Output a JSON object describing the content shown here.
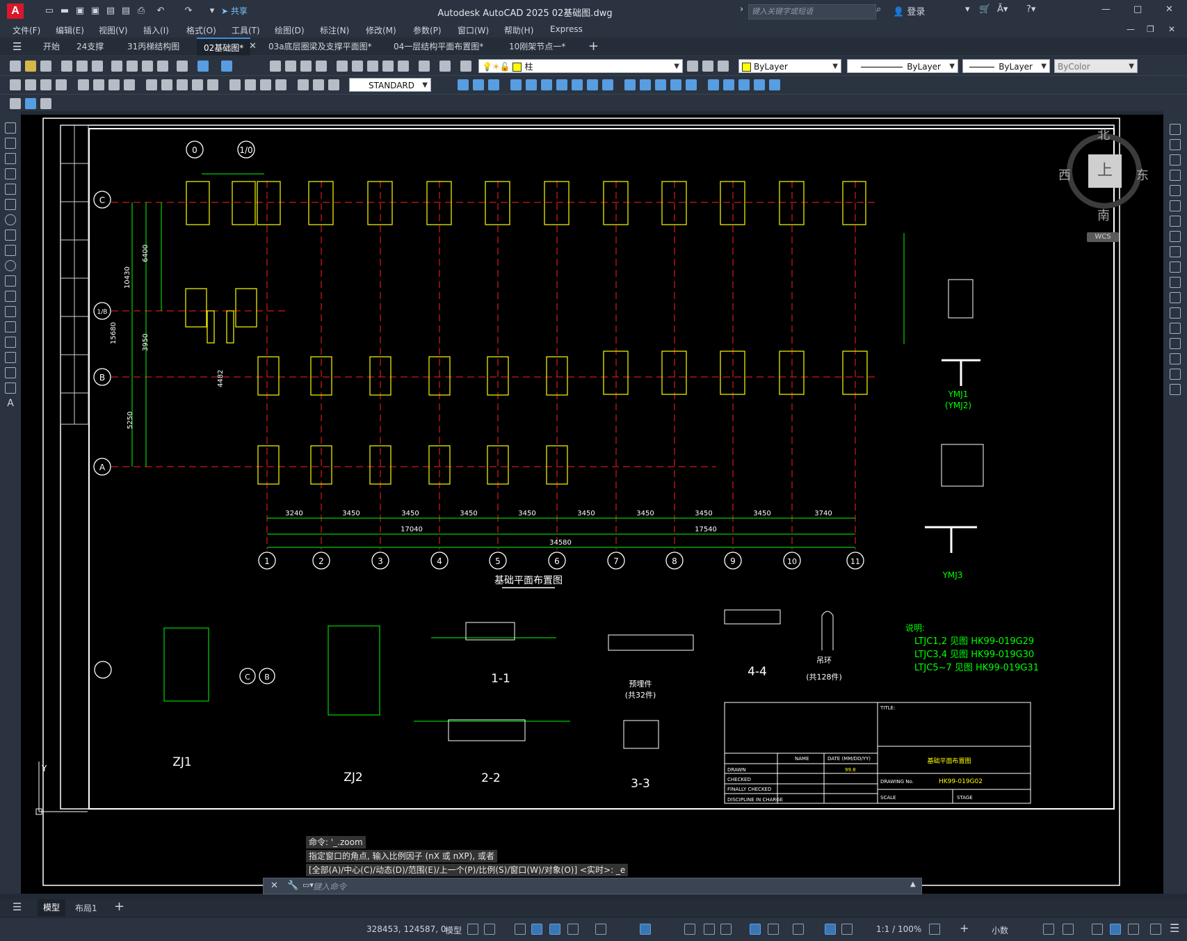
{
  "app": {
    "title": "Autodesk AutoCAD 2025    02基础图.dwg",
    "share": "共享",
    "search_placeholder": "键入关键字或短语",
    "login": "登录"
  },
  "menu": [
    "文件(F)",
    "编辑(E)",
    "视图(V)",
    "插入(I)",
    "格式(O)",
    "工具(T)",
    "绘图(D)",
    "标注(N)",
    "修改(M)",
    "参数(P)",
    "窗口(W)",
    "帮助(H)",
    "Express"
  ],
  "tabs": [
    {
      "label": "开始",
      "active": false
    },
    {
      "label": "24支撑",
      "active": false
    },
    {
      "label": "31丙梯结构图",
      "active": false
    },
    {
      "label": "02基础图*",
      "active": true
    },
    {
      "label": "03a底层圈梁及支撑平面图*",
      "active": false
    },
    {
      "label": "04一层结构平面布置图*",
      "active": false
    },
    {
      "label": "10刚架节点一*",
      "active": false
    }
  ],
  "toolbar": {
    "layer": "柱",
    "color": "ByLayer",
    "linetype": "ByLayer",
    "lineweight": "ByLayer",
    "plotstyle": "ByColor",
    "textstyle": "STANDARD"
  },
  "viewcube": {
    "north": "北",
    "south": "南",
    "east": "东",
    "west": "西",
    "top": "上",
    "wcs": "WCS"
  },
  "drawing": {
    "main_title": "基础平面布置图",
    "col_labels": [
      "1",
      "2",
      "3",
      "4",
      "5",
      "6",
      "7",
      "8",
      "9",
      "10",
      "11"
    ],
    "row_labels": [
      "C",
      "1/B",
      "B",
      "A"
    ],
    "top_axes": [
      "0",
      "1/0"
    ],
    "bay_dims": [
      "3240",
      "3450",
      "3450",
      "3450",
      "3450",
      "3450",
      "3450",
      "3450",
      "3450",
      "3740"
    ],
    "sub_totals": [
      "17040",
      "17540"
    ],
    "total": "34580",
    "left_dims": [
      "10430",
      "15680",
      "3950",
      "6400",
      "4482",
      "5250"
    ],
    "notes_title": "说明:",
    "notes": [
      "LTJC1,2 见图 HK99-019G29",
      "LTJC3,4 见图 HK99-019G30",
      "LTJC5~7 见图 HK99-019G31"
    ],
    "details": [
      "ZJ1",
      "ZJ2",
      "1-1",
      "2-2",
      "3-3",
      "4-4",
      "YMJ1",
      "(YMJ2)",
      "YMJ3"
    ],
    "detail_sub": {
      "yumaijian": "预埋件",
      "gong32": "(共32件)",
      "diaohuan": "吊环",
      "gong128": "(共128件)"
    },
    "title_block": {
      "title_label": "TITLE:",
      "title": "基础平面布置图",
      "name": "NAME",
      "date": "DATE (MM/DD/YY)",
      "date_val": "99.8",
      "drawn": "DRAWN",
      "checked": "CHECKED",
      "final": "FINALLY CHECKED",
      "discipline": "DISCIPLINE IN CHARGE",
      "drawing_no_label": "DRAWING No.",
      "drawing_no": "HK99-019G02",
      "scale": "SCALE",
      "stage": "STAGE"
    }
  },
  "command": {
    "history": [
      "命令: '_.zoom",
      "指定窗口的角点, 输入比例因子 (nX 或 nXP), 或者",
      "[全部(A)/中心(C)/动态(D)/范围(E)/上一个(P)/比例(S)/窗口(W)/对象(O)] <实时>: _e"
    ],
    "placeholder": "键入命令"
  },
  "layout_tabs": [
    "模型",
    "布局1"
  ],
  "status": {
    "coords": "328453, 124587, 0",
    "model": "模型",
    "scale": "1:1 / 100%",
    "units": "小数"
  }
}
